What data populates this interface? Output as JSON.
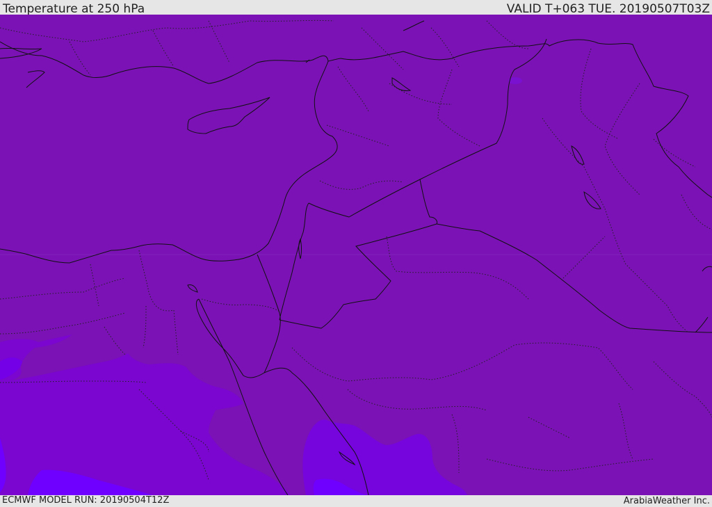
{
  "header": {
    "title": "Temperature at 250 hPa",
    "valid": "VALID T+063 TUE. 20190507T03Z"
  },
  "footer": {
    "model_run": "ECMWF MODEL RUN: 20190504T12Z",
    "brand": "ArabiaWeather Inc."
  },
  "map": {
    "colors": {
      "background_fill": "#7b12b5",
      "colder_fill": "#7300d9",
      "coldest_fill": "#6f00ff",
      "border_line": "#111111"
    }
  }
}
